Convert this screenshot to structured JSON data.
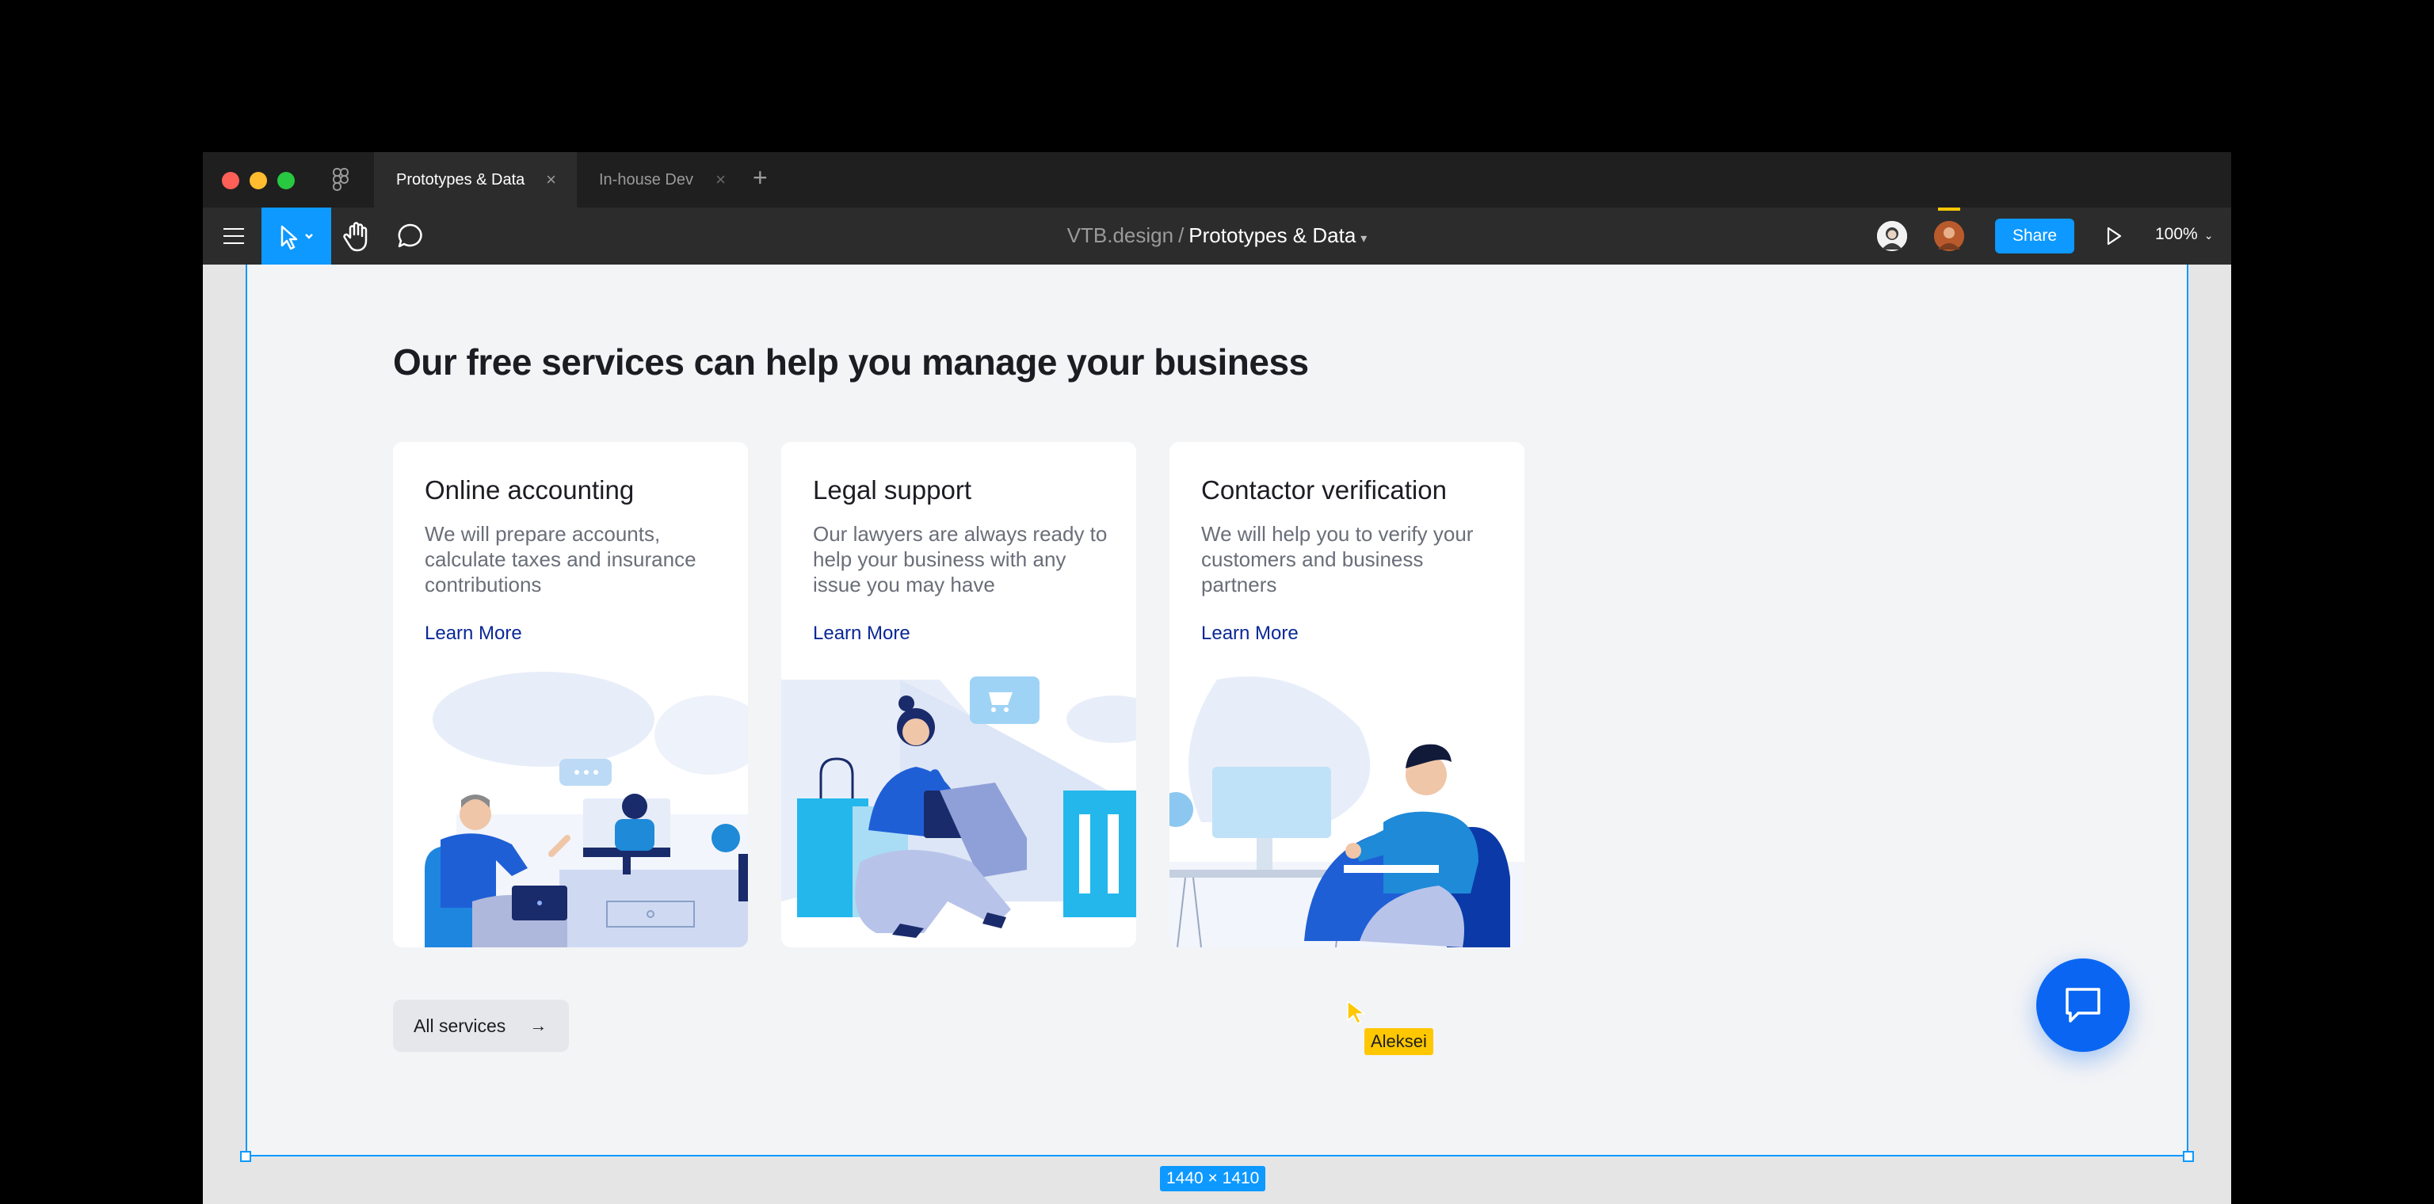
{
  "window": {
    "tabs": [
      {
        "label": "Prototypes & Data",
        "active": true
      },
      {
        "label": "In-house Dev",
        "active": false
      }
    ],
    "add_tab_symbol": "+",
    "close_symbol": "×"
  },
  "toolbar": {
    "project": "VTB.design",
    "separator": "/",
    "file_name": "Prototypes & Data",
    "share_label": "Share",
    "zoom": "100%",
    "accent": "#0d99ff"
  },
  "frame": {
    "dimensions_label": "1440 × 1410"
  },
  "page": {
    "heading": "Our free services can help you manage your business",
    "cards": [
      {
        "title": "Online accounting",
        "description": "We will prepare accounts, calculate taxes and insurance contributions",
        "link": "Learn More"
      },
      {
        "title": "Legal support",
        "description": "Our lawyers are always ready to help your business with any issue you may have",
        "link": "Learn More"
      },
      {
        "title": "Contactor verification",
        "description": "We will help you to verify your customers and business partners",
        "link": "Learn More"
      }
    ],
    "all_services_label": "All services",
    "all_services_arrow": "→"
  },
  "collaborator": {
    "name": "Aleksei",
    "color": "#ffc700"
  },
  "chat_button": {
    "icon": "chat-bubble-icon",
    "color": "#0a66f2"
  }
}
